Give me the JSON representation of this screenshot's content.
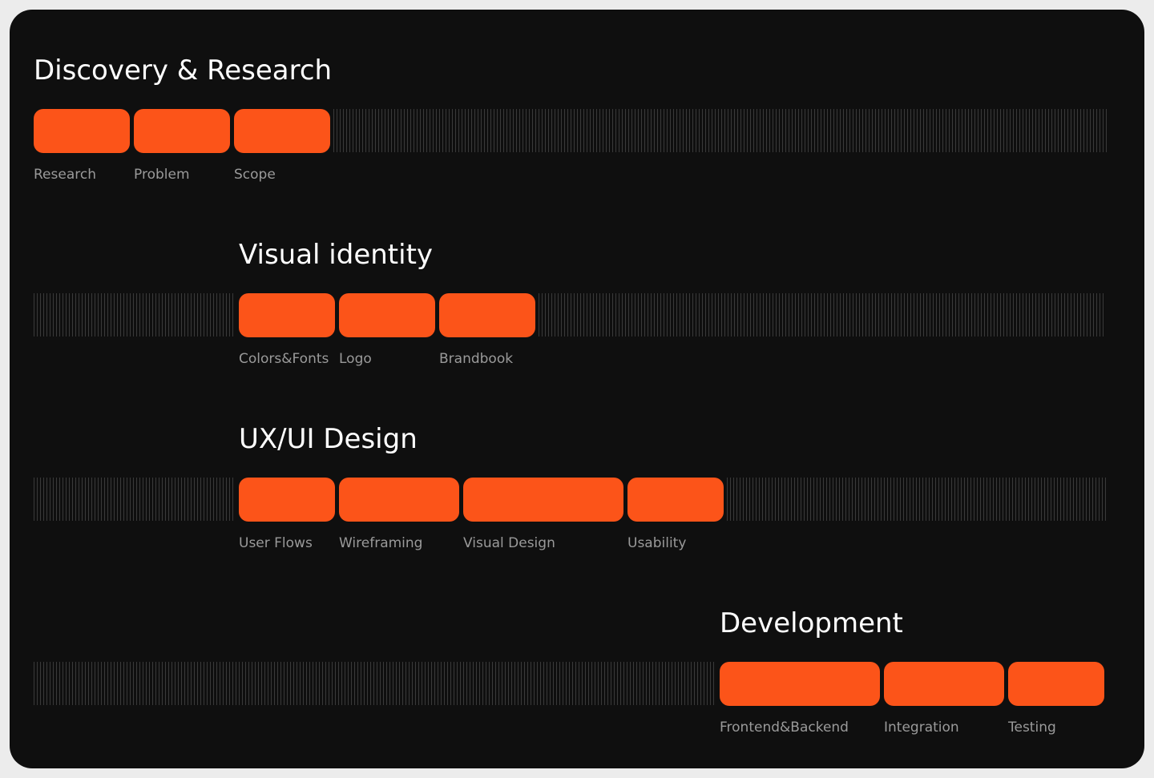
{
  "accent_color": "#fc5419",
  "stages": [
    {
      "title": "Discovery & Research",
      "steps": [
        "Research",
        "Problem",
        "Scope"
      ]
    },
    {
      "title": "Visual identity",
      "steps": [
        "Colors&Fonts",
        "Logo",
        "Brandbook"
      ]
    },
    {
      "title": "UX/UI Design",
      "steps": [
        "User Flows",
        "Wireframing",
        "Visual Design",
        "Usability"
      ]
    },
    {
      "title": "Development",
      "steps": [
        "Frontend&Backend",
        "Integration",
        "Testing"
      ]
    }
  ]
}
